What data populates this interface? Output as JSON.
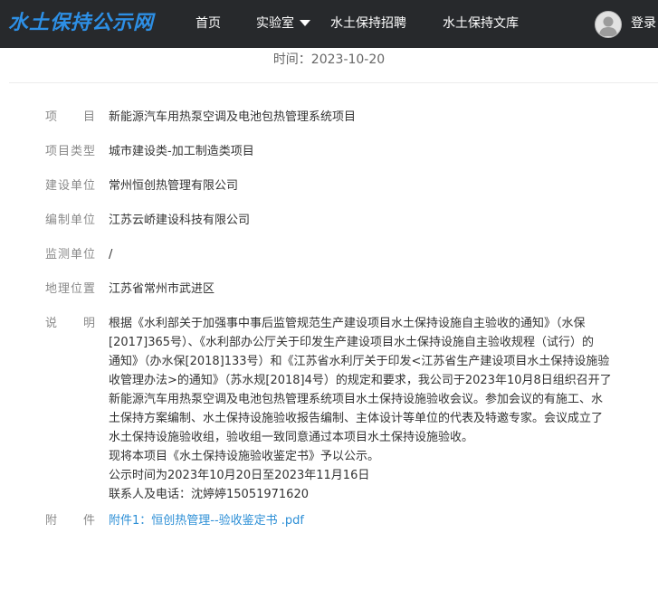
{
  "site": {
    "logo_text": "水土保持公示网"
  },
  "nav": {
    "home": "首页",
    "lab": "实验室",
    "recruit": "水土保持招聘",
    "library": "水土保持文库",
    "login": "登录"
  },
  "page": {
    "publish_time": "时间：2023-10-20"
  },
  "details": {
    "project": {
      "label": "项目",
      "value": "新能源汽车用热泵空调及电池包热管理系统项目"
    },
    "project_type": {
      "label": "项目类型",
      "value": "城市建设类-加工制造类项目"
    },
    "builder": {
      "label": "建设单位",
      "value": "常州恒创热管理有限公司"
    },
    "compiler": {
      "label": "编制单位",
      "value": "江苏云峤建设科技有限公司"
    },
    "monitor": {
      "label": "监测单位",
      "value": "/"
    },
    "location": {
      "label": "地理位置",
      "value": "江苏省常州市武进区"
    },
    "description": {
      "label": "说明",
      "lines": [
        "根据《水利部关于加强事中事后监管规范生产建设项目水土保持设施自主验收的通知》（水保",
        "[2017]365号）、《水利部办公厅关于印发生产建设项目水土保持设施自主验收规程（试行）的",
        "通知》（办水保[2018]133号）和《江苏省水利厅关于印发<江苏省生产建设项目水土保持设施验",
        "收管理办法>的通知》（苏水规[2018]4号）的规定和要求，我公司于2023年10月8日组织召开了",
        "新能源汽车用热泵空调及电池包热管理系统项目水土保持设施验收会议。参加会议的有施工、水",
        "土保持方案编制、水土保持设施验收报告编制、主体设计等单位的代表及特邀专家。会议成立了",
        "水土保持设施验收组，验收组一致同意通过本项目水土保持设施验收。",
        "现将本项目《水土保持设施验收鉴定书》予以公示。",
        "公示时间为2023年10月20日至2023年11月16日",
        "联系人及电话：沈婷婷15051971620"
      ]
    },
    "attachment": {
      "label": "附件",
      "link_text": "附件1：恒创热管理--验收鉴定书 .pdf"
    }
  }
}
